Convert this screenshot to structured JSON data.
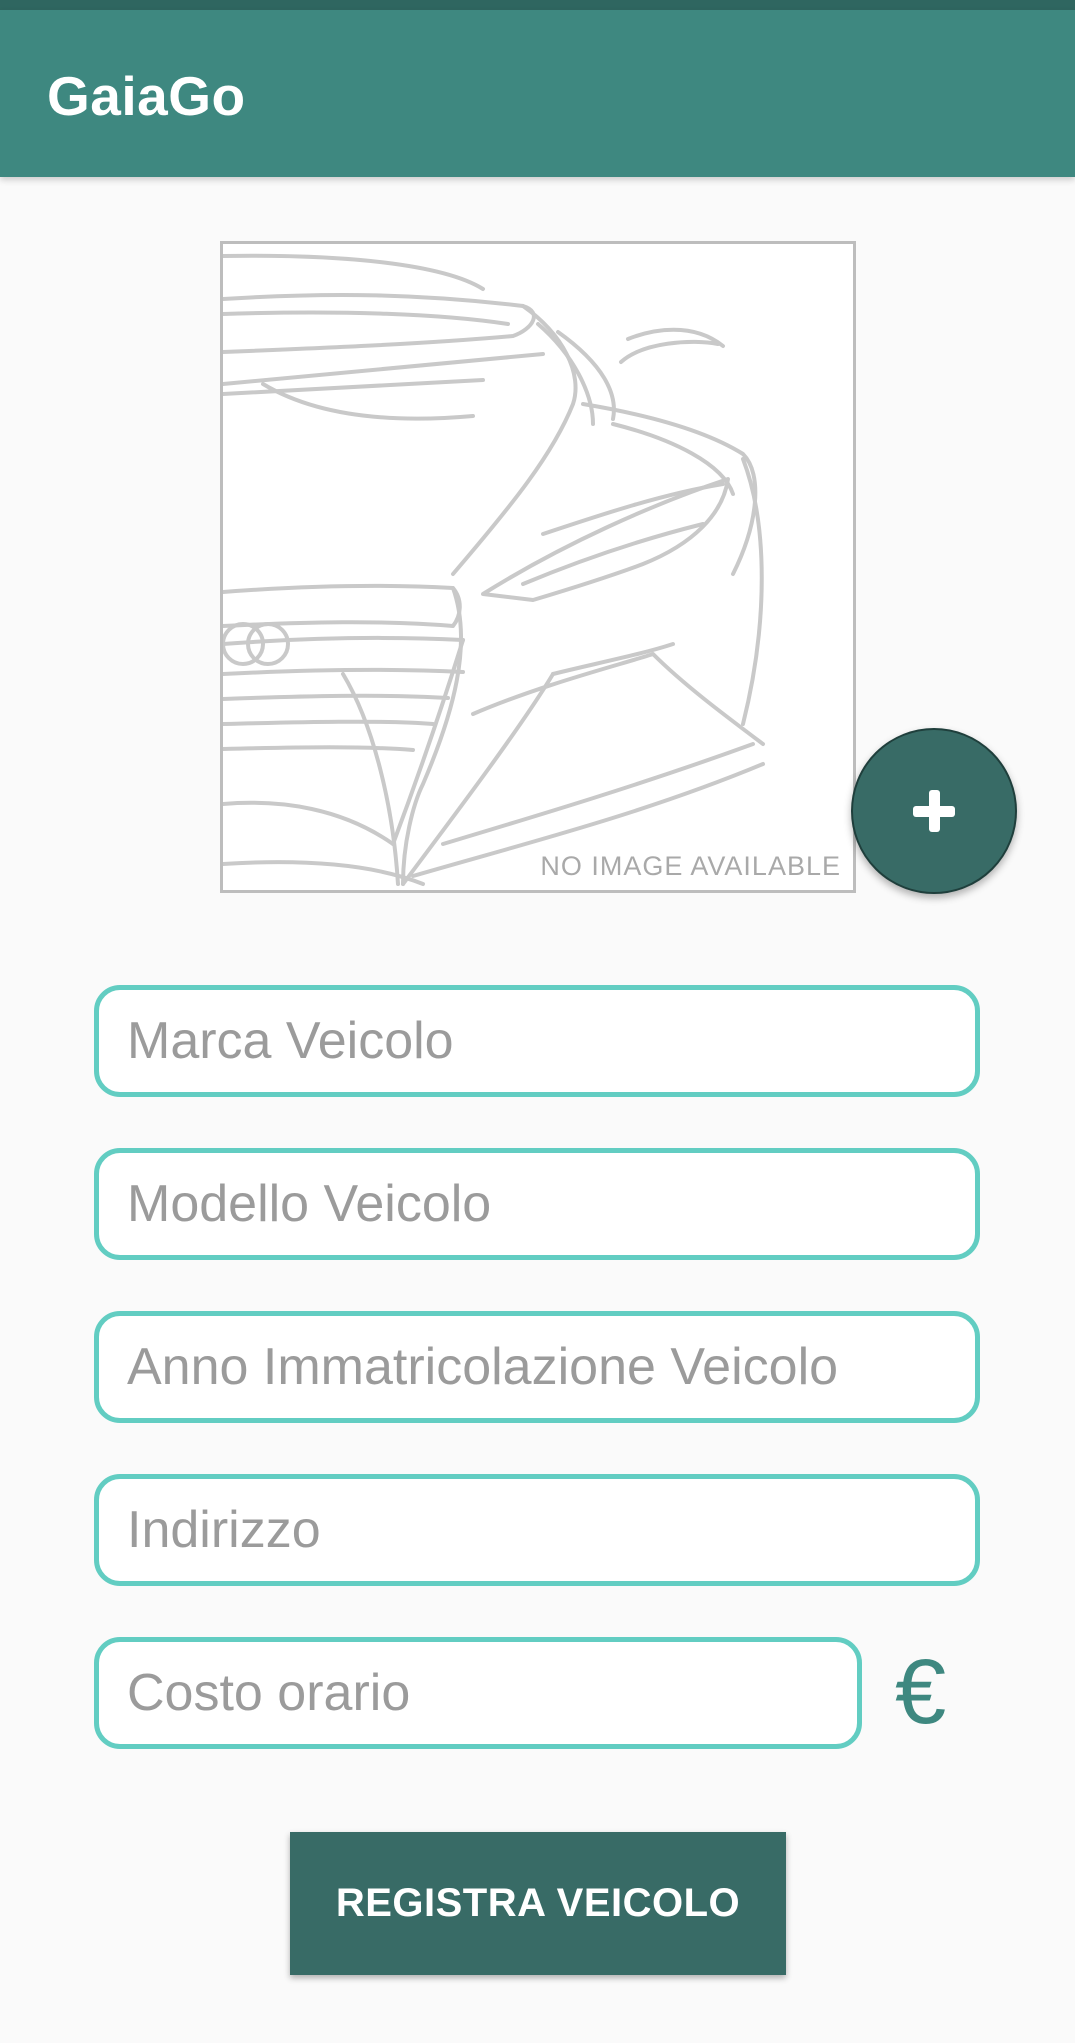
{
  "app_bar": {
    "title": "GaiaGo"
  },
  "vehicle_image": {
    "placeholder_caption": "NO IMAGE AVAILABLE",
    "add_button_icon": "plus-icon"
  },
  "form": {
    "marca_placeholder": "Marca Veicolo",
    "modello_placeholder": "Modello Veicolo",
    "anno_placeholder": "Anno Immatricolazione Veicolo",
    "indirizzo_placeholder": "Indirizzo",
    "costo_placeholder": "Costo orario",
    "currency_symbol": "€",
    "submit_label": "REGISTRA VEICOLO"
  },
  "colors": {
    "app_bar": "#3e8880",
    "status_bar": "#2f6660",
    "accent_dark": "#386b66",
    "field_border": "#62cdc2",
    "background": "#fafafa"
  }
}
